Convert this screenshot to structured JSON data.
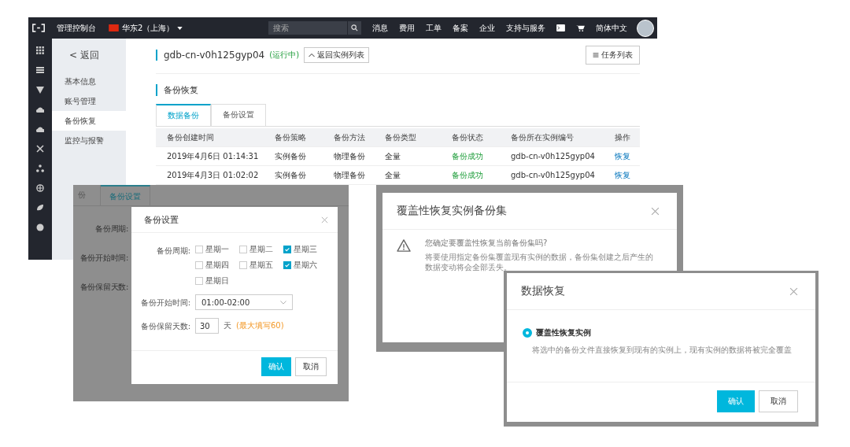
{
  "console": {
    "topbar": {
      "title": "管理控制台",
      "region": "华东2（上海）",
      "search_placeholder": "搜索",
      "links": [
        "消息",
        "费用",
        "工单",
        "备案",
        "企业",
        "支持与服务"
      ],
      "language": "简体中文"
    },
    "sidebar": {
      "back": "< 返回",
      "items": [
        {
          "label": "基本信息",
          "selected": false
        },
        {
          "label": "账号管理",
          "selected": false
        },
        {
          "label": "备份恢复",
          "selected": true
        },
        {
          "label": "监控与报警",
          "selected": false
        }
      ]
    },
    "instance": {
      "name": "gdb-cn-v0h125gyp04",
      "status": "(运行中)",
      "back_button": "返回实例列表",
      "task_button": "任务列表"
    },
    "section_title": "备份恢复",
    "tabs": [
      {
        "label": "数据备份",
        "selected": true
      },
      {
        "label": "备份设置",
        "selected": false
      }
    ],
    "table": {
      "columns": [
        "备份创建时间",
        "备份策略",
        "备份方法",
        "备份类型",
        "备份状态",
        "备份所在实例编号",
        "操作"
      ],
      "rows": [
        [
          "2019年4月6日 01:14:31",
          "实例备份",
          "物理备份",
          "全量",
          "备份成功",
          "gdb-cn-v0h125gyp04",
          "恢复"
        ],
        [
          "2019年4月3日 01:02:02",
          "实例备份",
          "物理备份",
          "全量",
          "备份成功",
          "gdb-cn-v0h125gyp04",
          "恢复"
        ]
      ]
    }
  },
  "settings_shot": {
    "bg_tabs": [
      {
        "label": "份",
        "selected": false
      },
      {
        "label": "备份设置",
        "selected": true
      }
    ],
    "bg_labels": [
      "备份周期:",
      "备份开始时间:",
      "备份保留天数:"
    ],
    "dialog": {
      "title": "备份设置",
      "period_label": "备份周期:",
      "days": [
        {
          "label": "星期一",
          "checked": false
        },
        {
          "label": "星期二",
          "checked": false
        },
        {
          "label": "星期三",
          "checked": true
        },
        {
          "label": "星期四",
          "checked": false
        },
        {
          "label": "星期五",
          "checked": false
        },
        {
          "label": "星期六",
          "checked": true
        },
        {
          "label": "星期日",
          "checked": false
        }
      ],
      "start_label": "备份开始时间:",
      "start_value": "01:00-02:00",
      "retain_label": "备份保留天数:",
      "retain_value": "30",
      "retain_unit": "天",
      "retain_hint": "(最大填写60)",
      "confirm": "确认",
      "cancel": "取消"
    }
  },
  "overwrite_shot": {
    "title": "覆盖性恢复实例备份集",
    "question": "您确定要覆盖性恢复当前备份集吗?",
    "detail": "将要使用指定备份集覆盖现有实例的数据，备份集创建之后产生的数据变动将会全部丢失。"
  },
  "restore_shot": {
    "title": "数据恢复",
    "options": [
      {
        "label": "覆盖性恢复实例",
        "selected": true
      }
    ],
    "description": "将选中的备份文件直接恢复到现有的实例上，现有实例的数据将被完全覆盖",
    "confirm": "确认",
    "cancel": "取消"
  }
}
